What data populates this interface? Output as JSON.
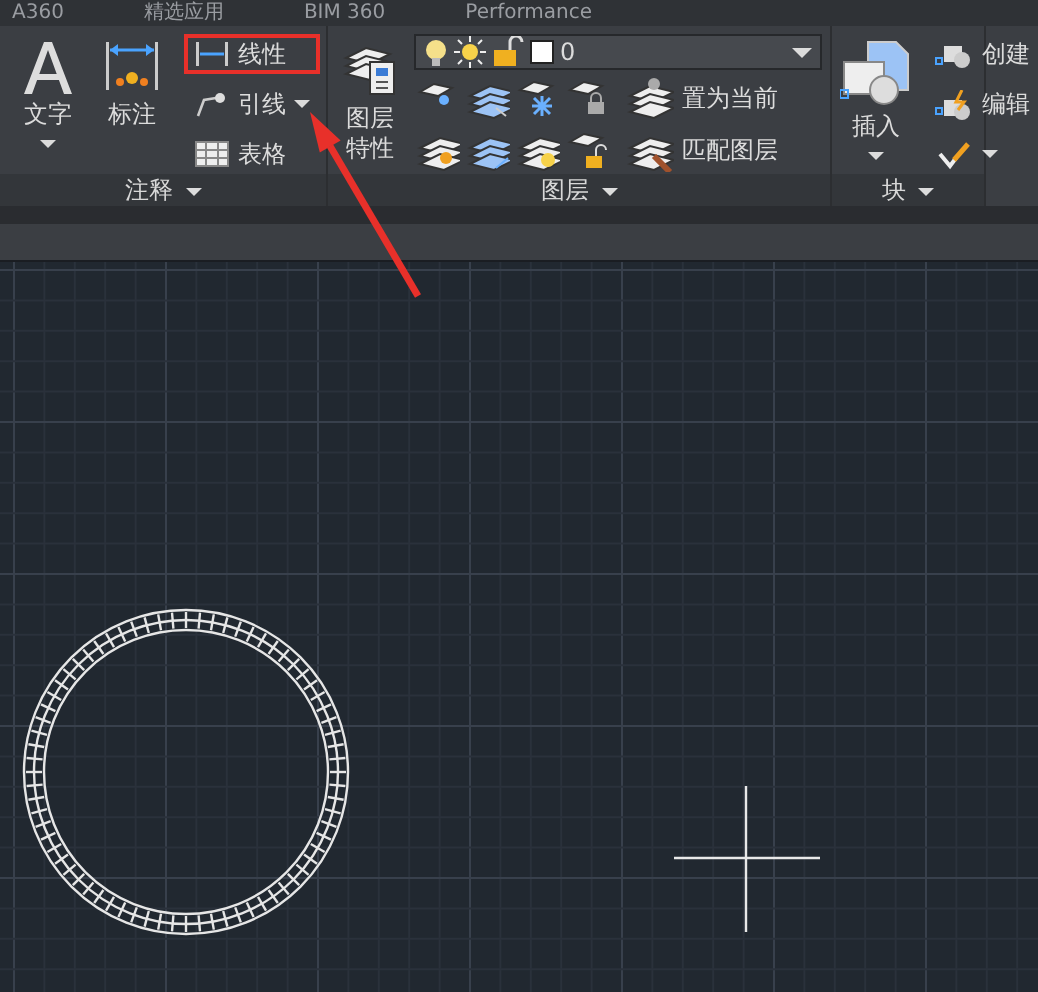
{
  "ribbon_tabs": [
    "A360",
    "精选应用",
    "BIM 360",
    "Performance"
  ],
  "annotation_panel": {
    "title": "注释",
    "large_tools": [
      {
        "kind": "text",
        "label": "文字"
      },
      {
        "kind": "dimension",
        "label": "标注"
      }
    ],
    "small_tools": [
      {
        "kind": "linear",
        "label": "线性",
        "highlighted": true
      },
      {
        "kind": "leader",
        "label": "引线",
        "highlighted": false
      },
      {
        "kind": "table",
        "label": "表格",
        "highlighted": false
      }
    ]
  },
  "layers_panel": {
    "title": "图层",
    "large_tool": "图层特性",
    "layer_dropdown": {
      "value": "0"
    },
    "tools": [
      "置为当前",
      "匹配图层"
    ]
  },
  "block_panel": {
    "title": "块",
    "large_tool": "插入",
    "tools": [
      {
        "kind": "create",
        "label": "创建"
      },
      {
        "kind": "edit",
        "label": "编辑"
      },
      {
        "kind": "attribute"
      }
    ]
  }
}
